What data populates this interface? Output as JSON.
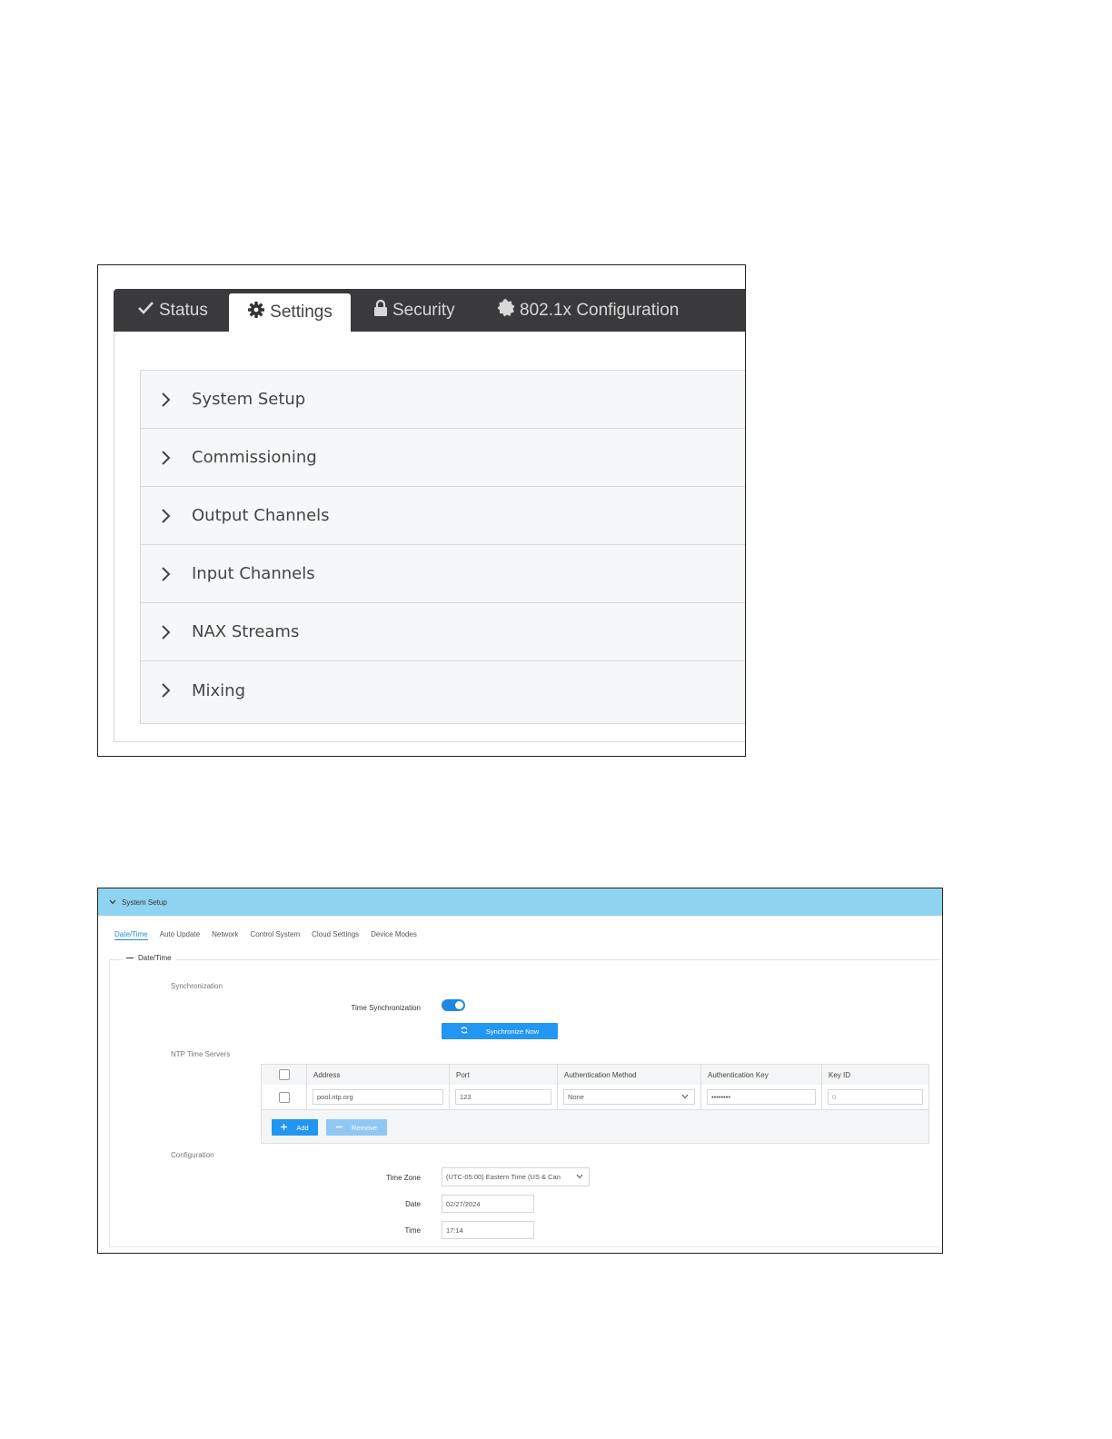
{
  "settings_screen": {
    "tabs": [
      {
        "label": "Status",
        "icon": "check-icon",
        "active": false
      },
      {
        "label": "Settings",
        "icon": "gear-icon",
        "active": true
      },
      {
        "label": "Security",
        "icon": "lock-icon",
        "active": false
      },
      {
        "label": "802.1x Configuration",
        "icon": "badge-icon",
        "active": false
      }
    ],
    "sections": [
      "System Setup",
      "Commissioning",
      "Output Channels",
      "Input Channels",
      "NAX Streams",
      "Mixing"
    ]
  },
  "system_setup_screen": {
    "header": "System Setup",
    "subtabs": [
      "Date/Time",
      "Auto Update",
      "Network",
      "Control System",
      "Cloud Settings",
      "Device Modes"
    ],
    "active_subtab": "Date/Time",
    "group_title": "Date/Time",
    "synchronization": {
      "section_label": "Synchronization",
      "time_sync_label": "Time Synchronization",
      "time_sync_enabled": true,
      "sync_now_label": "Synchronize Now"
    },
    "ntp": {
      "section_label": "NTP Time Servers",
      "columns": [
        "Address",
        "Port",
        "Authentication Method",
        "Authentication Key",
        "Key ID"
      ],
      "rows": [
        {
          "address": "pool.ntp.org",
          "port": "123",
          "auth_method": "None",
          "auth_key": "••••••••",
          "key_id": "0"
        }
      ],
      "add_label": "Add",
      "remove_label": "Remove"
    },
    "configuration": {
      "section_label": "Configuration",
      "time_zone_label": "Time Zone",
      "time_zone_value": "(UTC-05:00) Eastern Time (US & Can",
      "date_label": "Date",
      "date_value": "02/27/2024",
      "time_label": "Time",
      "time_value": "17:14"
    }
  },
  "colors": {
    "tabbar": "#3a3a3c",
    "header_blue": "#8fd3f0",
    "accent": "#2196f3"
  }
}
